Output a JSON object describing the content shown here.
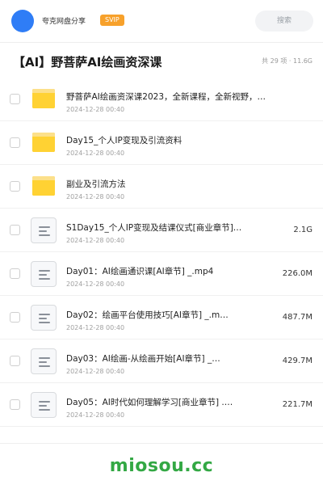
{
  "header": {
    "share_name": "夸克网盘分享",
    "badge": "SVIP",
    "search_placeholder": "搜索",
    "accent_color": "#2f7df6",
    "badge_color": "#f7a12b"
  },
  "folder": {
    "title": "【AI】野菩萨AI绘画资深课",
    "meta": "共 29 项 · 11.6G"
  },
  "files": [
    {
      "type": "folder",
      "icon": "folder-icon",
      "name": "野菩萨AI绘画资深课2023，全新课程，全新视野，…",
      "date": "2024-12-28 00:40",
      "size": ""
    },
    {
      "type": "folder",
      "icon": "folder-icon",
      "name": "Day15_个人IP变现及引流资料",
      "date": "2024-12-28 00:40",
      "size": ""
    },
    {
      "type": "folder",
      "icon": "folder-icon",
      "name": "副业及引流方法",
      "date": "2024-12-28 00:40",
      "size": ""
    },
    {
      "type": "file",
      "icon": "document-icon",
      "name": "S1Day15_个人IP变现及结课仪式[商业章节]…",
      "date": "2024-12-28 00:40",
      "size": "2.1G"
    },
    {
      "type": "file",
      "icon": "document-icon",
      "name": "Day01：AI绘画通识课[AI章节] _.mp4",
      "date": "2024-12-28 00:40",
      "size": "226.0M"
    },
    {
      "type": "file",
      "icon": "document-icon",
      "name": "Day02：绘画平台使用技巧[AI章节] _.m…",
      "date": "2024-12-28 00:40",
      "size": "487.7M"
    },
    {
      "type": "file",
      "icon": "document-icon",
      "name": "Day03：AI绘画-从绘画开始[AI章节] _…",
      "date": "2024-12-28 00:40",
      "size": "429.7M"
    },
    {
      "type": "file",
      "icon": "document-icon",
      "name": "Day05：AI时代如何理解学习[商业章节] .…",
      "date": "2024-12-28 00:40",
      "size": "221.7M"
    }
  ],
  "watermark": "miosou.cc"
}
